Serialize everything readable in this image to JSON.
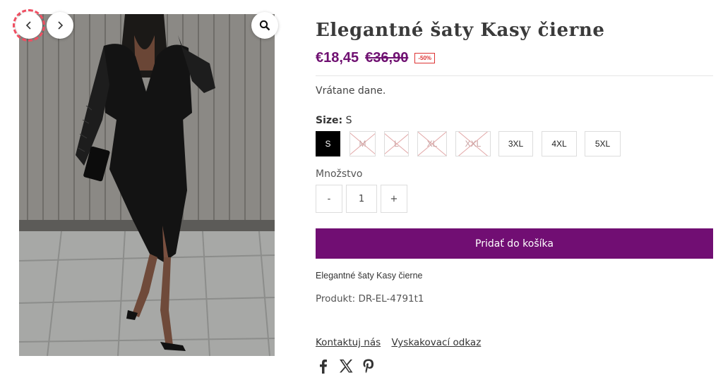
{
  "gallery": {
    "image_alt": "Elegantné šaty Kasy čierne",
    "prev_icon": "chevron-left-icon",
    "next_icon": "chevron-right-icon",
    "zoom_icon": "magnifier-icon"
  },
  "product": {
    "title": "Elegantné šaty Kasy čierne",
    "price": "€18,45",
    "old_price": "€36,90",
    "discount_badge": "-50%",
    "tax_note": "Vrátane dane.",
    "size_label": "Size:",
    "selected_size": "S",
    "sizes": [
      {
        "label": "S",
        "state": "selected"
      },
      {
        "label": "M",
        "state": "disabled"
      },
      {
        "label": "L",
        "state": "disabled"
      },
      {
        "label": "XL",
        "state": "disabled"
      },
      {
        "label": "XXL",
        "state": "disabled"
      },
      {
        "label": "3XL",
        "state": "available"
      },
      {
        "label": "4XL",
        "state": "available"
      },
      {
        "label": "5XL",
        "state": "available"
      }
    ],
    "quantity_label": "Množstvo",
    "quantity_minus": "-",
    "quantity_value": "1",
    "quantity_plus": "+",
    "add_to_cart": "Pridať do košíka",
    "description": "Elegantné šaty Kasy čierne",
    "sku": "Produkt: DR-EL-4791t1"
  },
  "links": {
    "contact": "Kontaktuj nás",
    "popup": "Vyskakovací odkaz"
  },
  "social": [
    "facebook-icon",
    "x-icon",
    "pinterest-icon"
  ],
  "colors": {
    "accent": "#710e73",
    "price": "#6f1071",
    "badge": "#dd3333",
    "selected_size_bg": "#000000"
  }
}
